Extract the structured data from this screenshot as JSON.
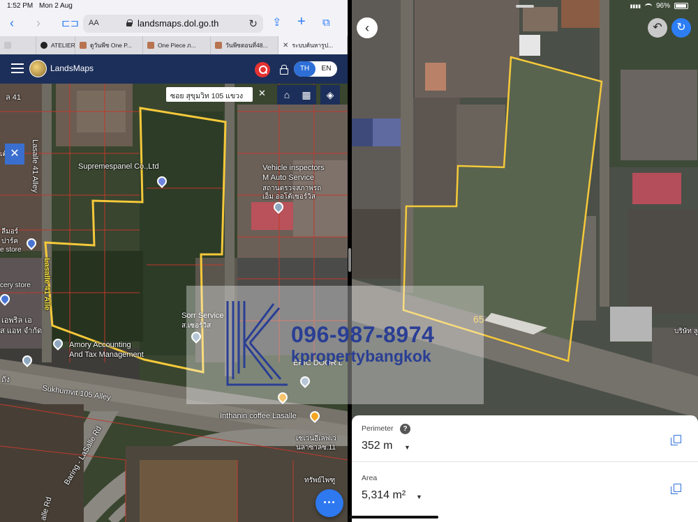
{
  "status_bar": {
    "time": "1:52 PM",
    "date": "Mon 2 Aug",
    "battery": "96%"
  },
  "safari": {
    "url": "landsmaps.dol.go.th",
    "text_size_label": "AA",
    "tabs": [
      {
        "label": "ATELIER"
      },
      {
        "label": "ดูวันพีซ One P..."
      },
      {
        "label": "One Piece ภ..."
      },
      {
        "label": "วันพีซตอนที่48..."
      },
      {
        "label": "ระบบค้นหารูป..."
      }
    ]
  },
  "landsmaps": {
    "app_title": "LandsMaps",
    "lang_th": "TH",
    "lang_en": "EN",
    "search_text": "ซอย สุขุมวิท 105 แขวง",
    "left_labels": {
      "road_top": "ล 41",
      "lasalle_alley": "Lasalle 41 Alley",
      "lasalle_alley2": "Lasalle 41 Alle",
      "supremes": "Supremespanel Co.,Ltd",
      "vehicle1": "Vehicle inspectors",
      "vehicle2": "M Auto Service",
      "vehicle3": "สถานตรวจสภาพรถ",
      "vehicle4": "เอ็ม ออโต้เซอร์วิส",
      "store1": "ลีมอร์",
      "store2": "ปาร์ค",
      "store3": "e store",
      "store4": "cery store",
      "store5": "เต๊ะ",
      "sorr": "Sorr Service",
      "sorr2": "ส.เซอร์วิส",
      "aprils": "เอพริล เอ",
      "aprils2": "ส แอท จำกัด",
      "amory1": "Amory Accounting",
      "amory2": "And Tax Management",
      "epic": "EPIC DOOR L",
      "sukhumvit": "Sukhumvit 105 Alley",
      "inthanin": "Inthanin coffee Lasalle",
      "seven1": "เซเว่นอีเลฟเว่",
      "seven2": "นลาซาลซ.11",
      "sap": "ทรัพย์ไพฑู",
      "baring": "Baring - LaSalle Rd",
      "lasalle_rd": "alle Rd",
      "tang": "ถัง"
    }
  },
  "right_map": {
    "plot_number": "65",
    "corner_label": "บริษัท ลู"
  },
  "measure": {
    "perimeter_label": "Perimeter",
    "perimeter_value": "352 m",
    "area_label": "Area",
    "area_value": "5,314 m²"
  },
  "watermark": {
    "phone": "096-987-8974",
    "site": "kpropertybangkok"
  },
  "colors": {
    "boundary": "#f5c93a",
    "header": "#1c2f5a",
    "accent": "#2d6fd6",
    "parcel_lines": "#c0392b"
  }
}
